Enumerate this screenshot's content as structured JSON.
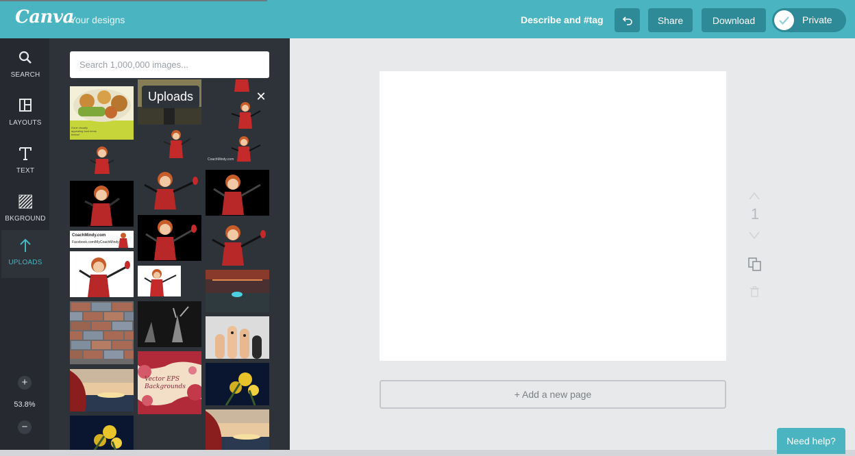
{
  "header": {
    "logo_text": "Canva",
    "your_designs": "Your designs",
    "describe_tag": "Describe and #tag",
    "share_label": "Share",
    "download_label": "Download",
    "privacy_label": "Private",
    "undo_icon": "undo-icon",
    "accent_color": "#4ab5c1",
    "button_color": "#2e8a96"
  },
  "rail": {
    "items": [
      {
        "label": "SEARCH",
        "icon": "search-icon"
      },
      {
        "label": "LAYOUTS",
        "icon": "layouts-icon"
      },
      {
        "label": "TEXT",
        "icon": "text-icon"
      },
      {
        "label": "BKGROUND",
        "icon": "background-icon"
      },
      {
        "label": "UPLOADS",
        "icon": "upload-icon",
        "active": true
      }
    ],
    "zoom_in": "+",
    "zoom_value": "53.8%",
    "zoom_out": "−"
  },
  "panel": {
    "search_placeholder": "Search 1,000,000 images...",
    "tooltip": "Uploads",
    "close": "✕",
    "thumb_texts": {
      "food_caption": "Gone visually appealing food items before!",
      "banner_line1": "CoachMindy.com",
      "banner_line2": "Facebook.com/MyCoachMindy",
      "watermark": "CoachMindy.com",
      "vector_text": "Vector EPS Backgrounds"
    }
  },
  "canvas": {
    "page_number": "1",
    "add_page_label": "+ Add a new page"
  },
  "help": {
    "label": "Need help?"
  }
}
